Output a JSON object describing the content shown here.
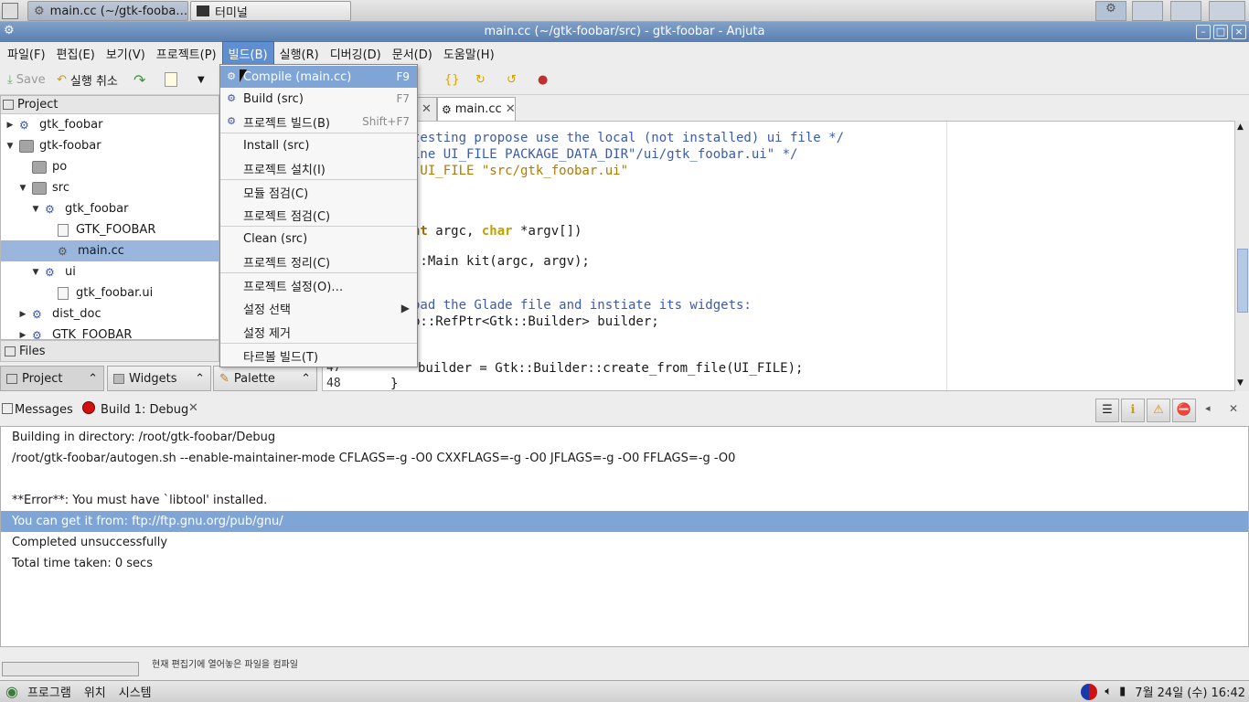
{
  "taskbar": {
    "tasks": [
      {
        "label": "main.cc (~/gtk-fooba…",
        "icon": "anjuta-icon",
        "active": true
      },
      {
        "label": "터미널",
        "icon": "terminal-icon",
        "active": false
      }
    ]
  },
  "window": {
    "title": "main.cc (~/gtk-foobar/src) - gtk-foobar - Anjuta"
  },
  "menubar": {
    "items": [
      "파일(F)",
      "편집(E)",
      "보기(V)",
      "프로젝트(P)",
      "빌드(B)",
      "실행(R)",
      "디버깅(D)",
      "문서(D)",
      "도움말(H)"
    ],
    "open_item": "빌드(B)"
  },
  "toolbar": {
    "save_label": "Save",
    "undo_label": "실행 취소"
  },
  "project_panel": {
    "title": "Project",
    "tree": [
      {
        "label": "gtk_foobar",
        "icon": "target-icon",
        "expander": "collapsed",
        "depth": 0
      },
      {
        "label": "gtk-foobar",
        "icon": "folder-icon",
        "expander": "expanded",
        "depth": 0
      },
      {
        "label": "po",
        "icon": "folder-icon",
        "expander": "none",
        "depth": 1
      },
      {
        "label": "src",
        "icon": "folder-icon",
        "expander": "expanded",
        "depth": 1
      },
      {
        "label": "gtk_foobar",
        "icon": "target-icon",
        "expander": "expanded",
        "depth": 2
      },
      {
        "label": "GTK_FOOBAR",
        "icon": "file-icon",
        "expander": "none",
        "depth": 3
      },
      {
        "label": "main.cc",
        "icon": "source-file-icon",
        "expander": "none",
        "depth": 3,
        "selected": true
      },
      {
        "label": "ui",
        "icon": "target-icon",
        "expander": "expanded",
        "depth": 2
      },
      {
        "label": "gtk_foobar.ui",
        "icon": "file-icon",
        "expander": "none",
        "depth": 3
      },
      {
        "label": "dist_doc",
        "icon": "target-icon",
        "expander": "collapsed",
        "depth": 1
      },
      {
        "label": "GTK_FOOBAR",
        "icon": "target-icon",
        "expander": "collapsed",
        "depth": 1
      }
    ],
    "files_label": "Files",
    "bottom_tabs": [
      "Project",
      "Widgets",
      "Palette"
    ]
  },
  "editor": {
    "active_tab": "main.cc",
    "lines": [
      {
        "num": "",
        "text": "testing propose use the local (not installed) ui file */",
        "cls": "c-comment"
      },
      {
        "num": "",
        "text": "ine UI_FILE PACKAGE_DATA_DIR\"/ui/gtk_foobar.ui\" */",
        "cls": "c-comment"
      },
      {
        "num": "",
        "text": " UI_FILE \"src/gtk_foobar.ui\"",
        "cls": "c-str"
      },
      {
        "num": "",
        "text": "nt argc, char *argv[])",
        "cls": ""
      },
      {
        "num": "",
        "text": "::Main kit(argc, argv);",
        "cls": ""
      },
      {
        "num": "",
        "text": "oad the Glade file and instiate its widgets:",
        "cls": "c-comment"
      },
      {
        "num": "",
        "text": "b::RefPtr<Gtk::Builder> builder;",
        "cls": ""
      },
      {
        "num": "47",
        "text": "builder = Gtk::Builder::create_from_file(UI_FILE);",
        "cls": ""
      },
      {
        "num": "48",
        "text": "}",
        "cls": ""
      }
    ]
  },
  "build_menu": {
    "items": [
      {
        "label": "Compile (main.cc)",
        "accel": "F9",
        "icon": "compile-icon",
        "highlighted": true
      },
      {
        "label": "Build (src)",
        "accel": "F7",
        "icon": "build-icon"
      },
      {
        "label": "프로젝트 빌드(B)",
        "accel": "Shift+F7",
        "icon": "build-project-icon"
      },
      {
        "label": "Install (src)",
        "accel": ""
      },
      {
        "label": "프로젝트 설치(I)",
        "accel": ""
      },
      {
        "label": "모듈 점검(C)",
        "accel": ""
      },
      {
        "label": "프로젝트 점검(C)",
        "accel": ""
      },
      {
        "label": "Clean (src)",
        "accel": ""
      },
      {
        "label": "프로젝트 정리(C)",
        "accel": ""
      },
      {
        "label": "프로젝트 설정(O)…",
        "accel": ""
      },
      {
        "label": "설정 선택",
        "accel": "",
        "submenu": true
      },
      {
        "label": "설정 제거",
        "accel": ""
      },
      {
        "label": "타르볼 빌드(T)",
        "accel": ""
      }
    ]
  },
  "messages": {
    "title": "Messages",
    "tab_label": "Build 1: Debug",
    "lines": [
      {
        "text": "Building in directory: /root/gtk-foobar/Debug"
      },
      {
        "text": "/root/gtk-foobar/autogen.sh --enable-maintainer-mode CFLAGS=-g -O0 CXXFLAGS=-g -O0 JFLAGS=-g -O0 FFLAGS=-g -O0"
      },
      {
        "text": ""
      },
      {
        "text": "**Error**: You must have `libtool' installed."
      },
      {
        "text": "You can get it from: ftp://ftp.gnu.org/pub/gnu/",
        "highlighted": true
      },
      {
        "text": "Completed unsuccessfully"
      },
      {
        "text": "Total time taken: 0 secs"
      }
    ]
  },
  "status": {
    "text": "현재 편집기에 열어놓은 파일을 컴파일"
  },
  "panel": {
    "menus": [
      "프로그램",
      "위치",
      "시스템"
    ],
    "clock": "7월 24일 (수) 16:42"
  }
}
